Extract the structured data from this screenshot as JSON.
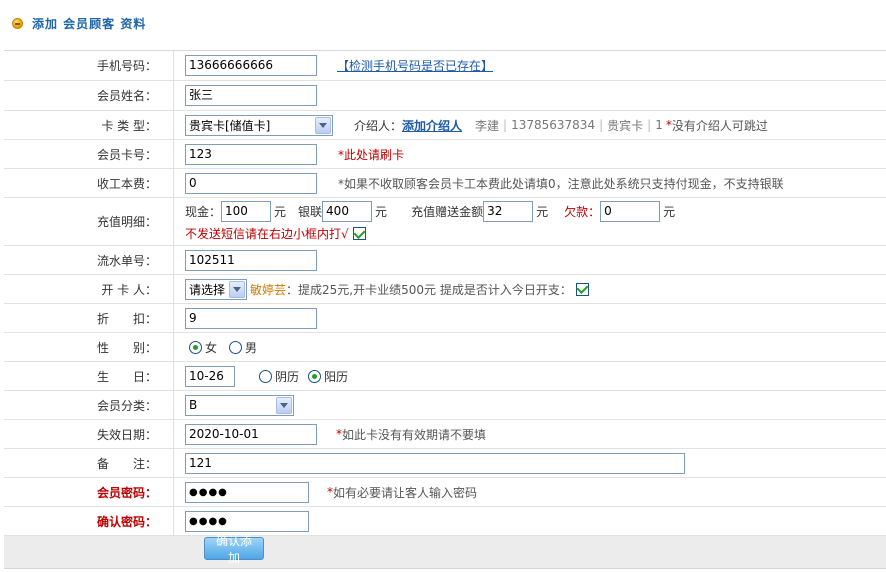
{
  "header": {
    "title": "添加 会员顾客 资料"
  },
  "form": {
    "phone": {
      "label": "手机号码：",
      "value": "13666666666",
      "check_link": "【检测手机号码是否已存在】"
    },
    "name": {
      "label": "会员姓名：",
      "value": "张三"
    },
    "card_type": {
      "label": "卡 类 型：",
      "selected": "贵宾卡[储值卡]",
      "introducer_label": "介绍人：",
      "add_introducer": "添加介绍人",
      "introducer_name": "李建",
      "introducer_phone": "13785637834",
      "introducer_card": "贵宾卡",
      "introducer_count": "1",
      "note_star": "*",
      "note": "没有介绍人可跳过"
    },
    "card_no": {
      "label": "会员卡号：",
      "value": "123",
      "note": "*此处请刷卡"
    },
    "fee": {
      "label": "收工本费：",
      "value": "0",
      "note": "*如果不收取顾客会员卡工本费此处请填0，注意此处系统只支持付现金，不支持银联"
    },
    "recharge": {
      "label": "充值明细：",
      "cash_label": "现金：",
      "cash_value": "100",
      "unit": "元",
      "union_label": "银联",
      "union_value": "400",
      "gift_label": "充值赠送金额",
      "gift_value": "32",
      "debt_label": "欠款：",
      "debt_value": "0",
      "sms_note": "不发送短信请在右边小框内打√",
      "sms_checked": true
    },
    "serial": {
      "label": "流水单号：",
      "value": "102511"
    },
    "opener": {
      "label": "开 卡 人：",
      "selected": "请选择",
      "name": "敏婷芸",
      "commission": "：提成25元,开卡业绩500元 提成是否计入今日开支：",
      "commission_checked": true
    },
    "discount": {
      "label": "折　　扣：",
      "value": "9"
    },
    "gender": {
      "label": "性　　别：",
      "options": [
        "女",
        "男"
      ],
      "selected": "女"
    },
    "birthday": {
      "label": "生　　日：",
      "value": "10-26",
      "options": [
        "阴历",
        "阳历"
      ],
      "selected": "阳历"
    },
    "category": {
      "label": "会员分类：",
      "selected": "B"
    },
    "expiry": {
      "label": "失效日期：",
      "value": "2020-10-01",
      "note_star": "*",
      "note": "如此卡没有有效期请不要填"
    },
    "remark": {
      "label": "备　　注：",
      "value": "121"
    },
    "password": {
      "label": "会员密码：",
      "value": "●●●●",
      "note_star": "*",
      "note": "如有必要请让客人输入密码"
    },
    "confirm_password": {
      "label": "确认密码：",
      "value": "●●●●"
    }
  },
  "footer": {
    "submit": "确认添加"
  },
  "colors": {
    "accent": "#1e5aa8",
    "warning": "#c00000",
    "highlight": "#d07a00"
  }
}
